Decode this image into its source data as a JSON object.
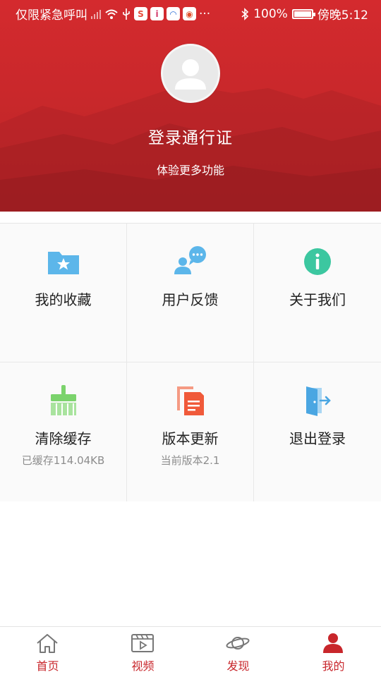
{
  "status_bar": {
    "carrier": "仅限紧急呼叫",
    "more": "···",
    "battery": "100%",
    "time": "傍晚5:12",
    "app_icons": [
      "app-icon-1",
      "app-icon-2",
      "app-icon-3",
      "app-icon-4"
    ]
  },
  "profile": {
    "title": "登录通行证",
    "subtitle": "体验更多功能"
  },
  "grid": [
    {
      "label": "我的收藏",
      "sublabel": "",
      "icon": "folder-star-icon"
    },
    {
      "label": "用户反馈",
      "sublabel": "",
      "icon": "user-feedback-icon"
    },
    {
      "label": "关于我们",
      "sublabel": "",
      "icon": "info-icon"
    },
    {
      "label": "清除缓存",
      "sublabel": "已缓存114.04KB",
      "icon": "broom-icon"
    },
    {
      "label": "版本更新",
      "sublabel": "当前版本2.1",
      "icon": "document-update-icon"
    },
    {
      "label": "退出登录",
      "sublabel": "",
      "icon": "logout-door-icon"
    }
  ],
  "nav": [
    {
      "label": "首页",
      "icon": "home-icon",
      "active": false
    },
    {
      "label": "视频",
      "icon": "video-icon",
      "active": false
    },
    {
      "label": "发现",
      "icon": "planet-icon",
      "active": false
    },
    {
      "label": "我的",
      "icon": "person-icon",
      "active": true
    }
  ],
  "colors": {
    "brand_red": "#c8262b",
    "folder_blue": "#5cb6ea",
    "info_green": "#3cc7a0",
    "broom_green": "#7bd36c",
    "update_red": "#f05a3a"
  }
}
